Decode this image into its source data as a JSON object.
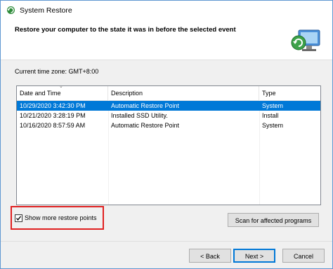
{
  "window": {
    "title": "System Restore",
    "heading": "Restore your computer to the state it was in before the selected event"
  },
  "timezone": {
    "label": "Current time zone: GMT+8:00"
  },
  "table": {
    "columns": [
      "Date and Time",
      "Description",
      "Type"
    ],
    "rows": [
      {
        "date": "10/29/2020 3:42:30 PM",
        "description": "Automatic Restore Point",
        "type": "System",
        "selected": true
      },
      {
        "date": "10/21/2020 3:28:19 PM",
        "description": "Installed SSD Utility.",
        "type": "Install",
        "selected": false
      },
      {
        "date": "10/16/2020 8:57:59 AM",
        "description": "Automatic Restore Point",
        "type": "System",
        "selected": false
      }
    ]
  },
  "options": {
    "show_more_label": "Show more restore points",
    "show_more_checked": true
  },
  "buttons": {
    "scan": "Scan for affected programs",
    "back": "< Back",
    "next": "Next >",
    "cancel": "Cancel"
  },
  "colors": {
    "selection": "#0078d7",
    "highlight_border": "#e02020"
  }
}
